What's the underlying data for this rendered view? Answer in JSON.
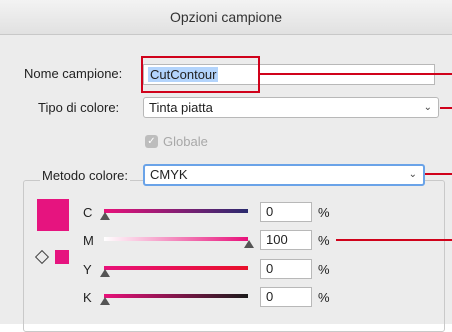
{
  "dialog": {
    "title": "Opzioni campione"
  },
  "name_field": {
    "label": "Nome campione:",
    "value": "CutContour"
  },
  "color_type": {
    "label": "Tipo di colore:",
    "value": "Tinta piatta"
  },
  "global": {
    "label": "Globale",
    "checked": true,
    "enabled": false
  },
  "color_mode": {
    "label": "Metodo colore:",
    "value": "CMYK"
  },
  "channels": [
    {
      "name": "C",
      "value": "0",
      "unit": "%"
    },
    {
      "name": "M",
      "value": "100",
      "unit": "%"
    },
    {
      "name": "Y",
      "value": "0",
      "unit": "%"
    },
    {
      "name": "K",
      "value": "0",
      "unit": "%"
    }
  ],
  "colors": {
    "swatch": "#e6147f",
    "annotation": "#d0021b",
    "focus": "#6aa3e8"
  }
}
